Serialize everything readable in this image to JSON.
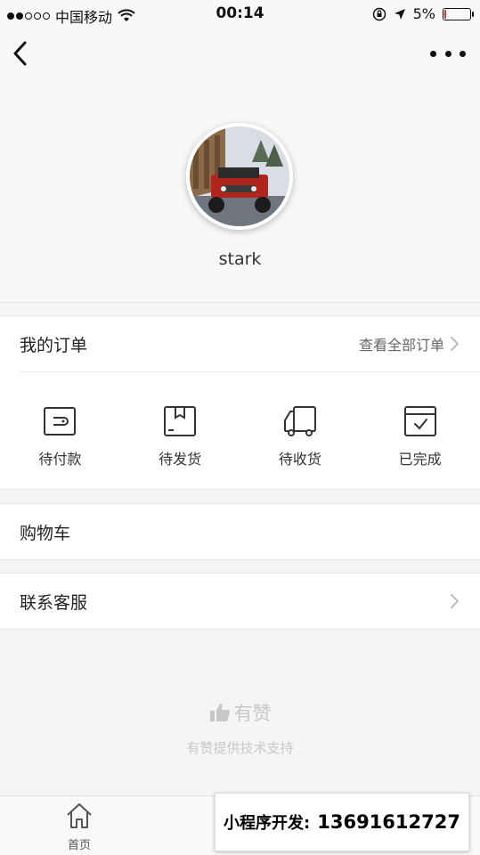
{
  "status_bar": {
    "carrier": "中国移动",
    "time": "00:14",
    "battery": "5%",
    "battery_level": 0.05
  },
  "nav": {
    "back_icon": "chevron-left-icon",
    "more_icon": "more-dots-icon"
  },
  "profile": {
    "username": "stark"
  },
  "orders": {
    "title": "我的订单",
    "view_all": "查看全部订单",
    "items": [
      {
        "label": "待付款",
        "icon": "wallet-icon"
      },
      {
        "label": "待发货",
        "icon": "box-icon"
      },
      {
        "label": "待收货",
        "icon": "truck-icon"
      },
      {
        "label": "已完成",
        "icon": "completed-icon"
      }
    ]
  },
  "cart": {
    "title": "购物车"
  },
  "service": {
    "title": "联系客服"
  },
  "brand": {
    "name": "有赞",
    "support": "有赞提供技术支持"
  },
  "tab_bar": {
    "items": [
      {
        "label": "首页",
        "icon": "home-icon"
      }
    ]
  },
  "promo": {
    "label": "小程序开发:",
    "phone": "13691612727"
  },
  "colors": {
    "background": "#f5f5f5",
    "card": "#ffffff",
    "brand_gray": "#c8c8c8"
  }
}
